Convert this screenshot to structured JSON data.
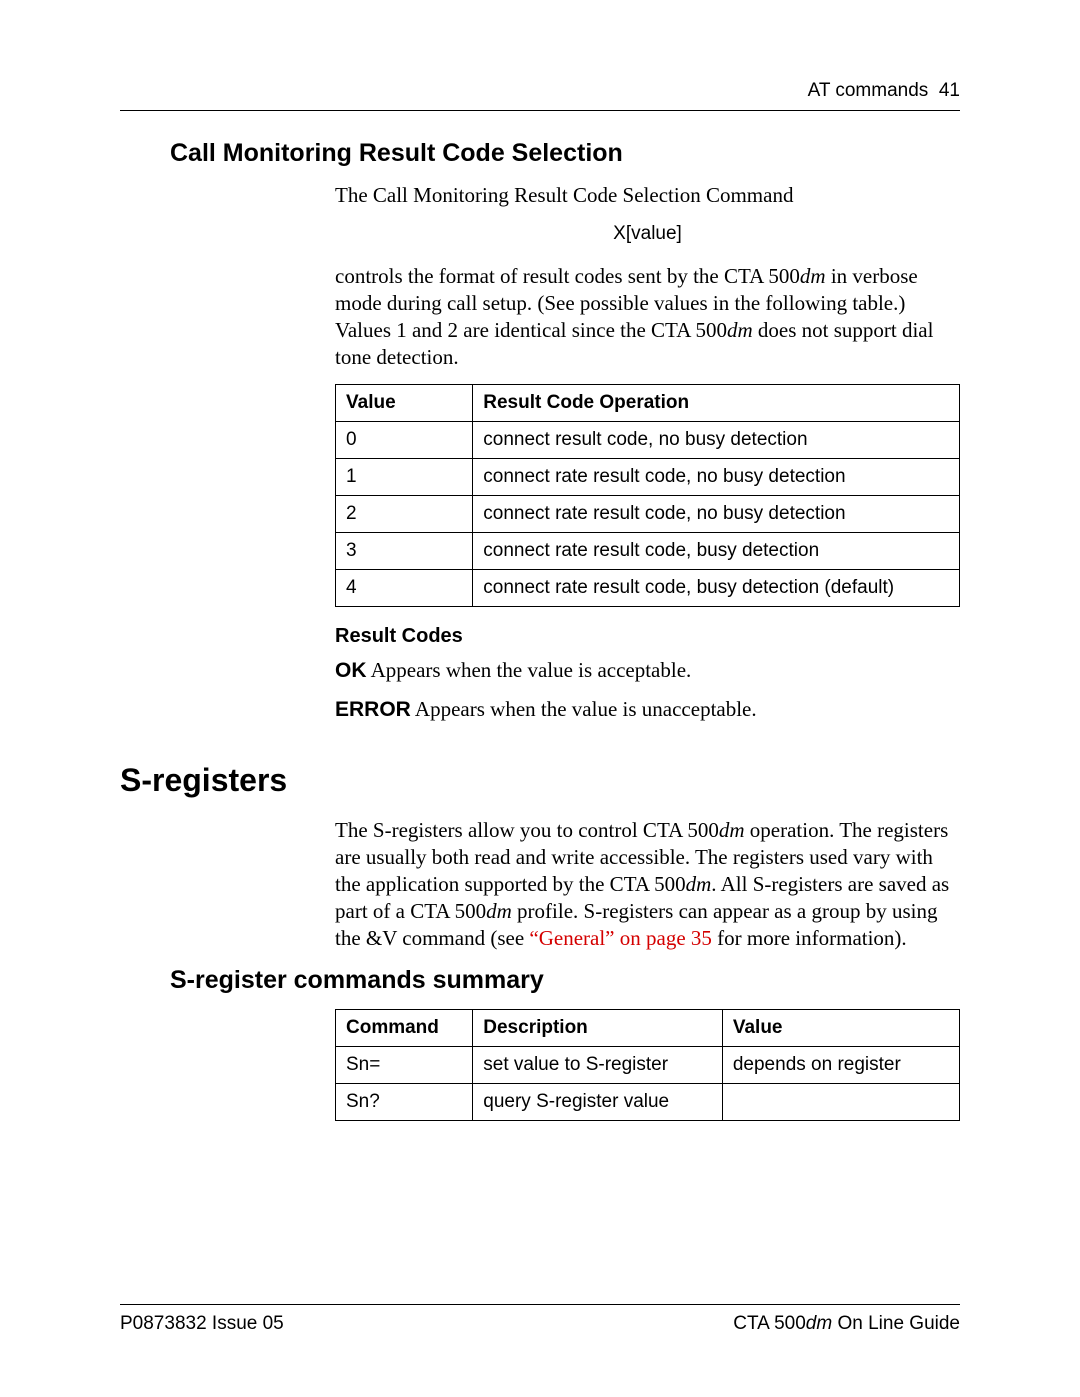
{
  "header": {
    "section": "AT commands",
    "page_no": "41"
  },
  "h_call_monitoring": "Call Monitoring Result Code Selection",
  "intro_line": "The Call Monitoring Result Code Selection Command",
  "cmd_syntax": "X[value]",
  "body_para_prefix": "controls the format of result codes sent by the CTA 500",
  "body_para_mid1": " in verbose mode during call setup. (See possible values in the following table.) Values 1 and 2 are identical since the CTA 500",
  "body_para_suffix": " does not support dial tone detection.",
  "dm": "dm",
  "table1": {
    "headers": [
      "Value",
      "Result Code Operation"
    ],
    "rows": [
      [
        "0",
        "connect result code, no busy detection"
      ],
      [
        "1",
        "connect rate result code, no busy detection"
      ],
      [
        "2",
        "connect rate result code, no busy detection"
      ],
      [
        "3",
        "connect rate result code, busy detection"
      ],
      [
        "4",
        "connect rate result code, busy detection (default)"
      ]
    ]
  },
  "h_result_codes": "Result Codes",
  "ok_label": "OK",
  "ok_text": "  Appears when the value is acceptable.",
  "error_label": "ERROR",
  "error_text": "  Appears when the value is unacceptable.",
  "h_sregisters": "S-registers",
  "sreg_p_prefix": "The S-registers allow you to control CTA 500",
  "sreg_p_mid1": " operation. The registers are usually both read and write accessible. The registers used vary with the application supported by the CTA 500",
  "sreg_p_mid2": ". All S-registers are saved as part of a CTA 500",
  "sreg_p_mid3": " profile. S-registers can appear as a group by using the &V command (see ",
  "sreg_link": "“General” on page 35",
  "sreg_p_suffix": " for more information).",
  "h_sreg_summary": "S-register commands summary",
  "table2": {
    "headers": [
      "Command",
      "Description",
      "Value"
    ],
    "rows": [
      [
        "Sn=",
        "set value to S-register",
        "depends on register"
      ],
      [
        "Sn?",
        "query S-register value",
        ""
      ]
    ]
  },
  "footer": {
    "left": "P0873832  Issue 05",
    "right_prefix": "CTA 500",
    "right_suffix": " On Line Guide"
  }
}
